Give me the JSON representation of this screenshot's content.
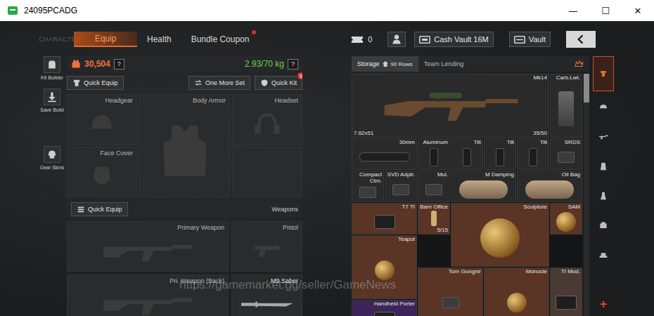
{
  "window": {
    "title": "24095PCADG",
    "controls": [
      "—",
      "☐",
      "✕"
    ]
  },
  "nav": {
    "section": "CHARACTER",
    "tabs": [
      {
        "label": "Equip",
        "selected": true,
        "dot": false
      },
      {
        "label": "Health",
        "selected": false,
        "dot": false
      },
      {
        "label": "Bundle Coupon",
        "selected": false,
        "dot": true
      }
    ],
    "tickets": "0",
    "cash_vault": "Cash Vault 16M",
    "vault": "Vault"
  },
  "sidebar": {
    "items": [
      "Kit Builder",
      "Save Build",
      "Gear Skins"
    ]
  },
  "loadout": {
    "value": "30,504",
    "help": "?",
    "weight": "2.93/70 kg",
    "quick_equip": "Quick Equip",
    "one_more_set": "One More Set",
    "quick_kit": "Quick Kit",
    "quick_kit_badge": "5",
    "gear_slots": [
      {
        "label": "Headgear"
      },
      {
        "label": "Body Armor"
      },
      {
        "label": "Headset"
      },
      {
        "label": "Face Cover"
      },
      {
        "label": ""
      }
    ],
    "weapons_quick_equip": "Quick Equip",
    "weapons_title": "Weapons",
    "weapon_slots": [
      {
        "label": "Primary Weapon",
        "filled": false
      },
      {
        "label": "Pistol",
        "filled": false
      },
      {
        "label": "Pri. Weapon (Back)",
        "filled": false
      },
      {
        "label": "M9 Saber",
        "filled": true
      }
    ]
  },
  "storage": {
    "tabs": [
      {
        "label": "Storage",
        "rows": "90 Rows",
        "selected": true
      },
      {
        "label": "Team Lending",
        "rows": "",
        "selected": false
      }
    ],
    "scroll_level": 0.12,
    "items": [
      {
        "name": "Mk14",
        "kind": "weapon",
        "color": "#2a2a2a",
        "caliber": "7.62x51",
        "count": "35/50"
      },
      {
        "name": "Carb.Lwt.",
        "kind": "stock",
        "color": "#2a2a2a",
        "caliber": "",
        "count": ""
      },
      {
        "name": "30mm",
        "kind": "scope",
        "color": "#2a2a2a",
        "caliber": "",
        "count": ""
      },
      {
        "name": "Aluminum",
        "kind": "grip",
        "color": "#2a2a2a",
        "caliber": "",
        "count": ""
      },
      {
        "name": "Tilt",
        "kind": "grip",
        "color": "#2a2a2a",
        "caliber": "",
        "count": ""
      },
      {
        "name": "Tilt",
        "kind": "grip",
        "color": "#2a2a2a",
        "caliber": "",
        "count": ""
      },
      {
        "name": "Tilt",
        "kind": "grip",
        "color": "#2a2a2a",
        "caliber": "",
        "count": ""
      },
      {
        "name": "SRDS",
        "kind": "part",
        "color": "#2a2a2a",
        "caliber": "",
        "count": ""
      },
      {
        "name": "Compact Ctrn.",
        "kind": "part",
        "color": "#2a2a2a",
        "caliber": "",
        "count": ""
      },
      {
        "name": "SVD Adptr.",
        "kind": "part",
        "color": "#2a2a2a",
        "caliber": "",
        "count": ""
      },
      {
        "name": "Mul.",
        "kind": "part",
        "color": "#2a2a2a",
        "caliber": "",
        "count": ""
      },
      {
        "name": "M Damping",
        "kind": "tube",
        "color": "#2a2a2a",
        "caliber": "",
        "count": ""
      },
      {
        "name": "Oil Bag",
        "kind": "tube",
        "color": "#2a2a2a",
        "caliber": "",
        "count": ""
      },
      {
        "name": "T7 TI",
        "kind": "device",
        "color": "#5a3424",
        "caliber": "",
        "count": ""
      },
      {
        "name": "Barn Office",
        "kind": "key",
        "color": "#5a3424",
        "caliber": "",
        "count": "5/15"
      },
      {
        "name": "Sculpture",
        "kind": "valuable",
        "color": "#5a3424",
        "caliber": "",
        "count": ""
      },
      {
        "name": "SAM",
        "kind": "valuable",
        "color": "#5a3424",
        "caliber": "",
        "count": ""
      },
      {
        "name": "Teapot",
        "kind": "valuable",
        "color": "#5a3424",
        "caliber": "",
        "count": ""
      },
      {
        "name": "Torn Gungnir",
        "kind": "part",
        "color": "#5a3424",
        "caliber": "",
        "count": ""
      },
      {
        "name": "Monocle",
        "kind": "valuable",
        "color": "#5a3424",
        "caliber": "",
        "count": ""
      },
      {
        "name": "TI Mod.",
        "kind": "device",
        "color": "#4a3a32",
        "caliber": "",
        "count": ""
      },
      {
        "name": "Handheld Porter",
        "kind": "device",
        "color": "#3e2458",
        "caliber": "",
        "count": ""
      }
    ]
  },
  "categories": [
    {
      "selected": true
    },
    {
      "selected": false
    },
    {
      "selected": false
    },
    {
      "selected": false
    },
    {
      "selected": false
    },
    {
      "selected": false
    },
    {
      "selected": false
    }
  ],
  "add_button": "+",
  "watermark": "https://gamemarket.gg/seller/GameNews"
}
